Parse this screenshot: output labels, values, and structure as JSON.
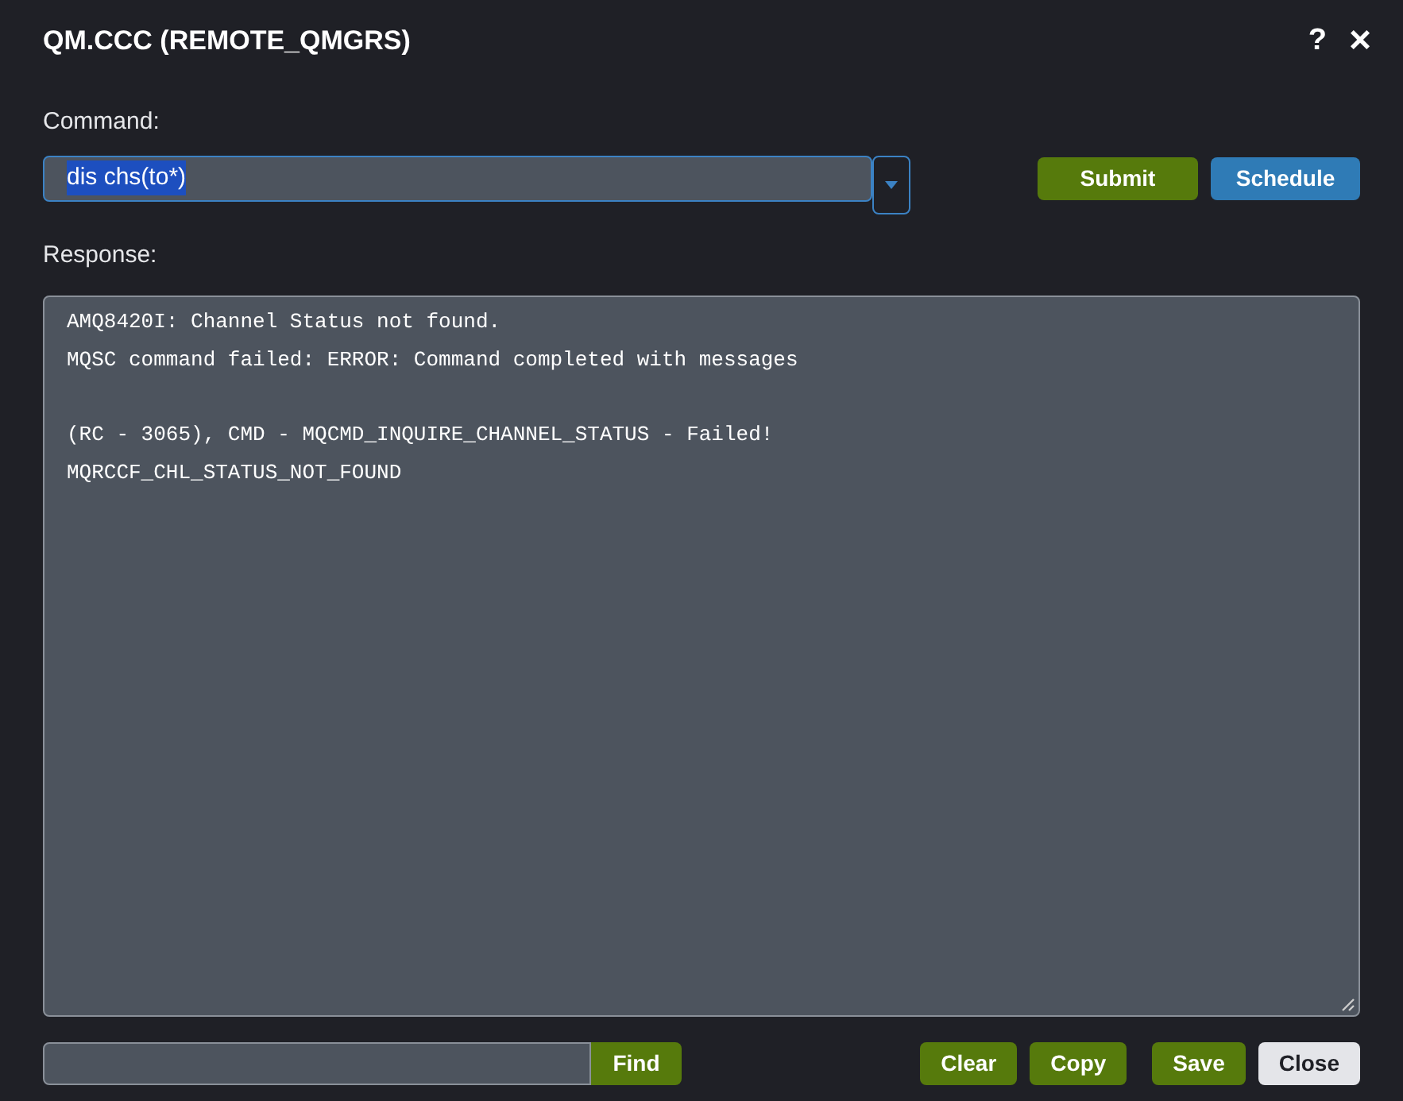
{
  "dialog": {
    "title": "QM.CCC (REMOTE_QMGRS)",
    "help": "?",
    "close": "×"
  },
  "command": {
    "label": "Command:",
    "value": "dis chs(to*)",
    "selected_text": true,
    "buttons": [
      "Submit",
      "Schedule"
    ]
  },
  "response": {
    "label": "Response:",
    "paragraphs": [
      [
        "AMQ8420I: Channel Status not found.",
        "MQSC command failed: ERROR: Command completed with messages"
      ],
      [
        "(RC - 3065), CMD - MQCMD_INQUIRE_CHANNEL_STATUS - Failed!",
        "MQRCCF_CHL_STATUS_NOT_FOUND"
      ]
    ]
  },
  "footer": {
    "find_button": "Find",
    "buttons": [
      {
        "label": "Clear",
        "kind": "primary"
      },
      {
        "label": "Copy",
        "kind": "primary"
      },
      {
        "label": "Save",
        "kind": "primary"
      },
      {
        "label": "Close",
        "kind": "secondary"
      }
    ]
  }
}
